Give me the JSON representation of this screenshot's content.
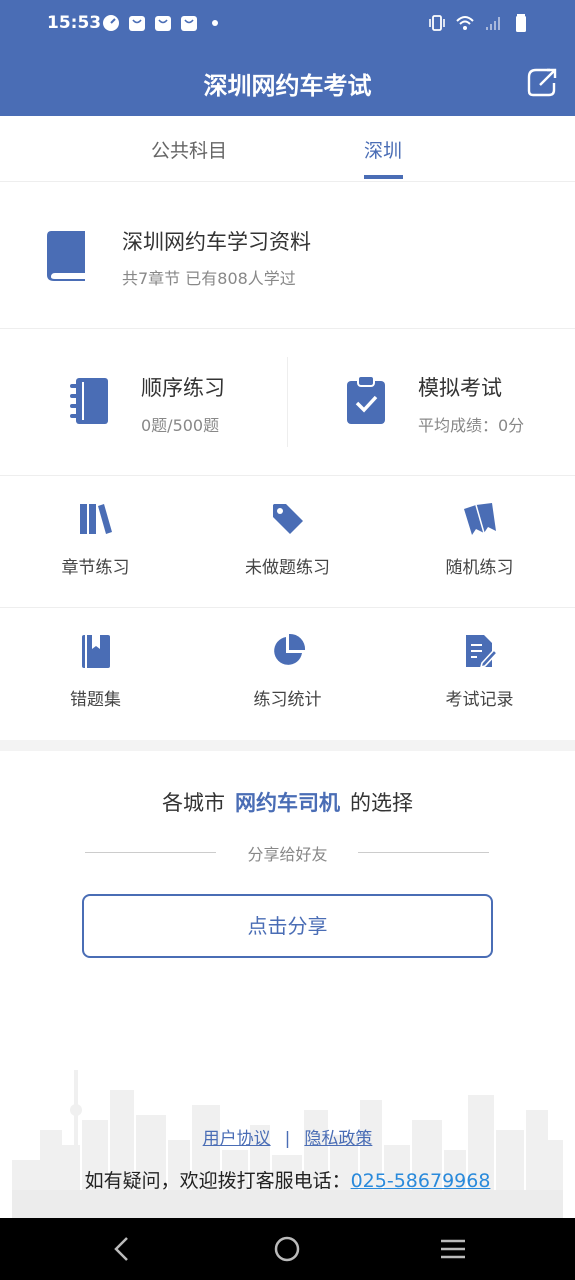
{
  "status_bar": {
    "time": "15:53"
  },
  "header": {
    "title": "深圳网约车考试"
  },
  "tabs": [
    {
      "label": "公共科目",
      "active": false
    },
    {
      "label": "深圳",
      "active": true
    }
  ],
  "study": {
    "title": "深圳网约车学习资料",
    "subtitle": "共7章节  已有808人学过"
  },
  "practice": {
    "sequential": {
      "title": "顺序练习",
      "subtitle": "0题/500题"
    },
    "mock_exam": {
      "title": "模拟考试",
      "subtitle": "平均成绩：0分"
    }
  },
  "grid": [
    {
      "label": "章节练习",
      "icon": "books-icon"
    },
    {
      "label": "未做题练习",
      "icon": "tag-icon"
    },
    {
      "label": "随机练习",
      "icon": "bookmarks-icon"
    },
    {
      "label": "错题集",
      "icon": "bookmark-book-icon"
    },
    {
      "label": "练习统计",
      "icon": "pie-chart-icon"
    },
    {
      "label": "考试记录",
      "icon": "document-edit-icon"
    }
  ],
  "promo": {
    "prefix": "各城市",
    "highlight": "网约车司机",
    "suffix": "的选择",
    "share_hint": "分享给好友",
    "share_button": "点击分享"
  },
  "footer": {
    "user_agreement": "用户协议",
    "separator": "|",
    "privacy_policy": "隐私政策",
    "contact_text": "如有疑问，欢迎拨打客服电话：",
    "phone": "025-58679968"
  },
  "colors": {
    "brand": "#4a6db5",
    "link": "#2a8adb"
  }
}
